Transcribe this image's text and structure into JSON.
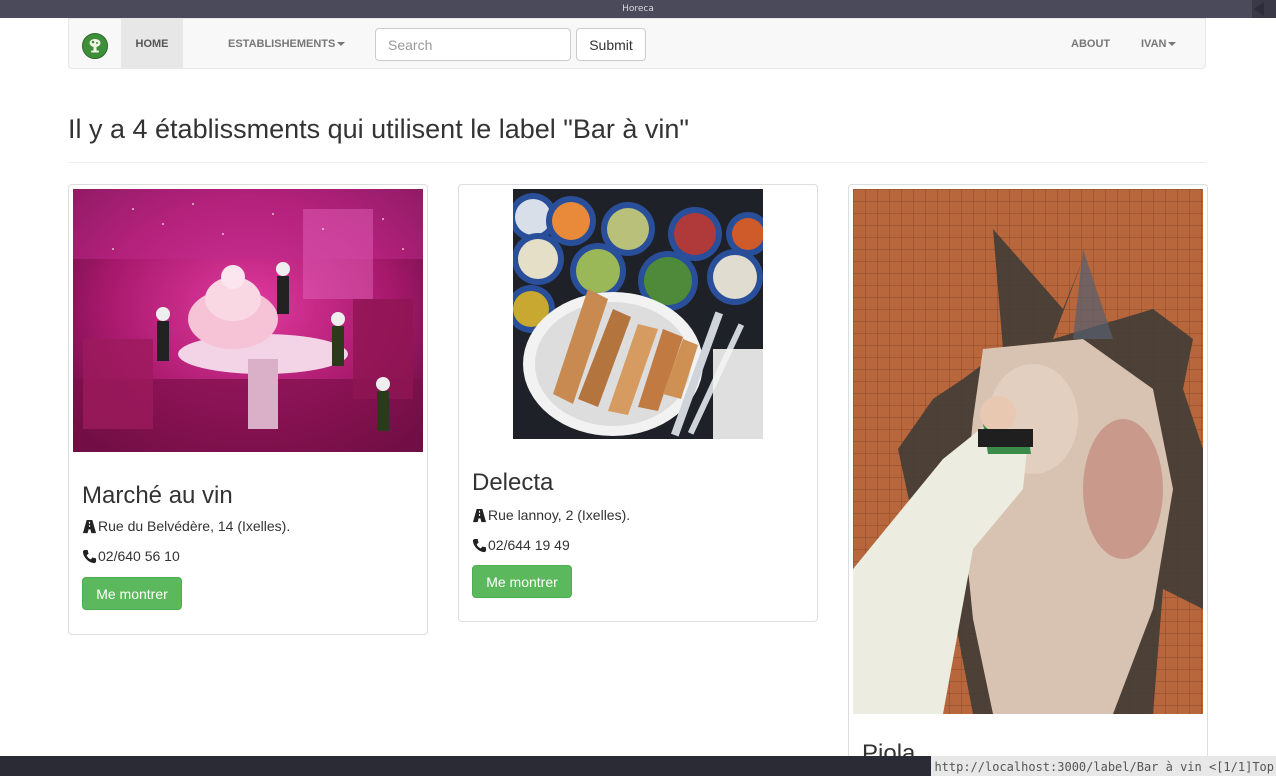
{
  "window": {
    "title": "Horeca"
  },
  "navbar": {
    "home_label": "HOME",
    "establishments_label": "ESTABLISHEMENTS",
    "search_placeholder": "Search",
    "submit_label": "Submit",
    "about_label": "ABOUT",
    "user_label": "IVAN"
  },
  "page": {
    "heading": "Il y a 4 établissments qui utilisent le label \"Bar à vin\""
  },
  "cards": [
    {
      "name": "Marché au vin",
      "address": "Rue du Belvédère, 14 (Ixelles).",
      "phone": "02/640 56 10",
      "button_label": "Me montrer",
      "image_desc": "pink-window-display"
    },
    {
      "name": "Delecta",
      "address": "Rue lannoy, 2 (Ixelles).",
      "phone": "02/644 19 49",
      "button_label": "Me montrer",
      "image_desc": "mezze-table"
    },
    {
      "name": "Piola",
      "image_desc": "street-art-mural"
    }
  ],
  "status": {
    "url": "http://localhost:3000/label/Bar à vin <[1/1]Top"
  },
  "colors": {
    "accent": "#5cb85c",
    "navbar_bg": "#f8f8f8",
    "brand": "#3d8f3a"
  }
}
